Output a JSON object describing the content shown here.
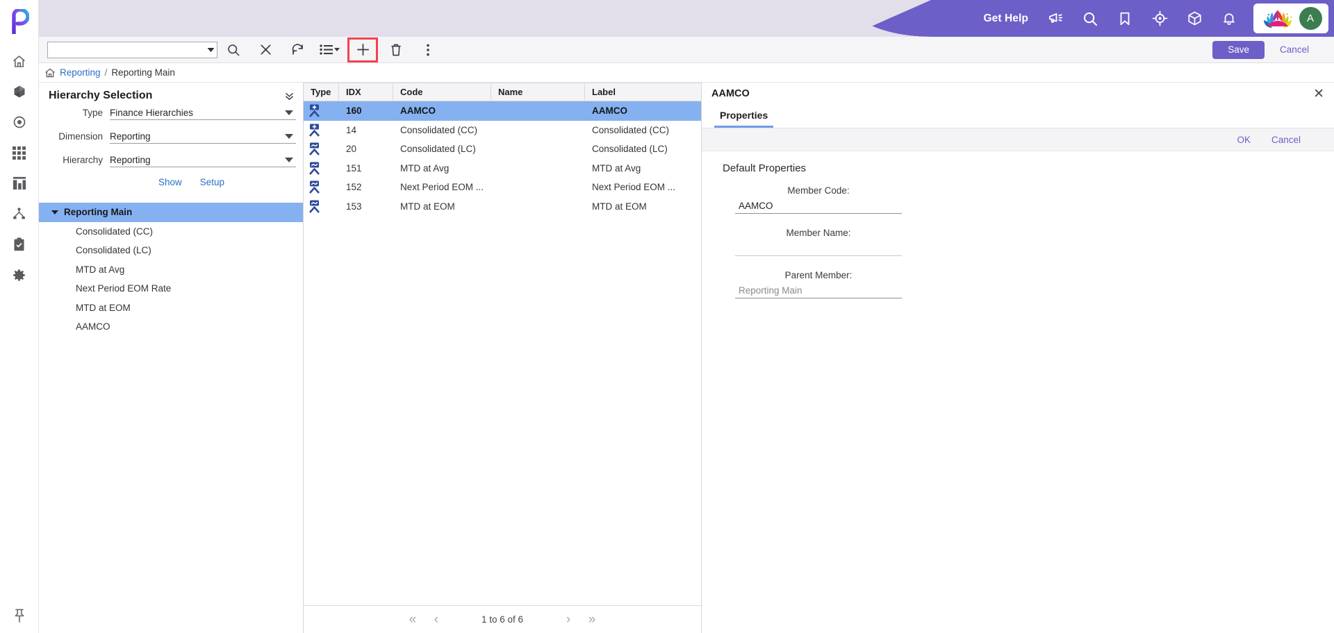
{
  "brand": {
    "logo_letter": "P",
    "accent_purple": "#6c5fc7",
    "header_lavender": "#e2dfeb",
    "selection_blue": "#85b1f0",
    "link_blue": "#2a6fc9",
    "highlight_red": "#f4424b",
    "avatar_green": "#3b7d4f"
  },
  "rail": {
    "logo_name": "platform-logo",
    "items": [
      {
        "name": "home-icon",
        "label": "Home"
      },
      {
        "name": "cube-icon",
        "label": "Models"
      },
      {
        "name": "target-circle-icon",
        "label": "Focus"
      },
      {
        "name": "grid-apps-icon",
        "label": "Applications"
      },
      {
        "name": "chart-bar-icon",
        "label": "Reports"
      },
      {
        "name": "hierarchy-icon",
        "label": "Hierarchies"
      },
      {
        "name": "clipboard-check-icon",
        "label": "Tasks"
      },
      {
        "name": "gear-icon",
        "label": "Settings"
      }
    ],
    "pin": {
      "name": "pin-icon",
      "label": "Pin navigation"
    }
  },
  "header": {
    "get_help": "Get Help",
    "icons": [
      {
        "name": "megaphone-icon",
        "label": "Announcements"
      },
      {
        "name": "search-icon",
        "label": "Search"
      },
      {
        "name": "bookmark-icon",
        "label": "Bookmarks"
      },
      {
        "name": "target-crosshair-icon",
        "label": "Navigator"
      },
      {
        "name": "cube-outline-icon",
        "label": "Modules"
      },
      {
        "name": "bell-icon",
        "label": "Notifications"
      }
    ],
    "company_logo_name": "lotus-logo",
    "avatar_initial": "A"
  },
  "toolbar": {
    "combo_value": "",
    "combo_placeholder": "",
    "buttons": [
      {
        "name": "search-icon",
        "label": "Search"
      },
      {
        "name": "clear-icon",
        "label": "Clear"
      },
      {
        "name": "refresh-icon",
        "label": "Refresh"
      },
      {
        "name": "list-view-icon",
        "label": "View options"
      },
      {
        "name": "add-plus-icon",
        "label": "Add member"
      },
      {
        "name": "trash-icon",
        "label": "Delete"
      },
      {
        "name": "more-vertical-icon",
        "label": "More actions"
      }
    ],
    "save_label": "Save",
    "cancel_label": "Cancel"
  },
  "breadcrumb": {
    "home_icon": "home-icon",
    "root": "Reporting",
    "separator": "/",
    "current": "Reporting Main"
  },
  "hierarchy_selection": {
    "title": "Hierarchy Selection",
    "fields": [
      {
        "label": "Type",
        "value": "Finance Hierarchies"
      },
      {
        "label": "Dimension",
        "value": "Reporting"
      },
      {
        "label": "Hierarchy",
        "value": "Reporting"
      }
    ],
    "links": [
      "Show",
      "Setup"
    ],
    "tree": [
      {
        "label": "Reporting Main",
        "level": 0,
        "expanded": true,
        "selected": true
      },
      {
        "label": "Consolidated (CC)",
        "level": 1,
        "expanded": false,
        "selected": false
      },
      {
        "label": "Consolidated (LC)",
        "level": 1,
        "expanded": false,
        "selected": false
      },
      {
        "label": "MTD at Avg",
        "level": 1,
        "expanded": false,
        "selected": false
      },
      {
        "label": "Next Period EOM Rate",
        "level": 1,
        "expanded": false,
        "selected": false
      },
      {
        "label": "MTD at EOM",
        "level": 1,
        "expanded": false,
        "selected": false
      },
      {
        "label": "AAMCO",
        "level": 1,
        "expanded": false,
        "selected": false
      }
    ]
  },
  "grid": {
    "columns": [
      "Type",
      "IDX",
      "Code",
      "Name",
      "Label"
    ],
    "rows": [
      {
        "type_icon": "member-add-node-icon",
        "idx": "160",
        "code": "AAMCO",
        "name": "",
        "label": "AAMCO",
        "selected": true
      },
      {
        "type_icon": "member-add-node-icon",
        "idx": "14",
        "code": "Consolidated (CC)",
        "name": "",
        "label": "Consolidated (CC)",
        "selected": false
      },
      {
        "type_icon": "member-calc-node-icon",
        "idx": "20",
        "code": "Consolidated (LC)",
        "name": "",
        "label": "Consolidated (LC)",
        "selected": false
      },
      {
        "type_icon": "member-calc-node-icon",
        "idx": "151",
        "code": "MTD at Avg",
        "name": "",
        "label": "MTD at Avg",
        "selected": false
      },
      {
        "type_icon": "member-calc-node-icon",
        "idx": "152",
        "code": "Next Period EOM ...",
        "name": "",
        "label": "Next Period EOM ...",
        "selected": false
      },
      {
        "type_icon": "member-calc-node-icon",
        "idx": "153",
        "code": "MTD at EOM",
        "name": "",
        "label": "MTD at EOM",
        "selected": false
      }
    ],
    "pagination": {
      "first": "«",
      "prev": "‹",
      "status": "1 to 6 of 6",
      "next": "›",
      "last": "»"
    }
  },
  "properties_panel": {
    "title": "AAMCO",
    "close_icon": "close-icon",
    "tab": "Properties",
    "ok_label": "OK",
    "cancel_label": "Cancel",
    "section_title": "Default Properties",
    "fields": [
      {
        "label": "Member Code:",
        "value": "AAMCO",
        "state": "filled"
      },
      {
        "label": "Member Name:",
        "value": "",
        "state": "empty"
      },
      {
        "label": "Parent Member:",
        "value": "Reporting Main",
        "state": "muted"
      }
    ]
  }
}
